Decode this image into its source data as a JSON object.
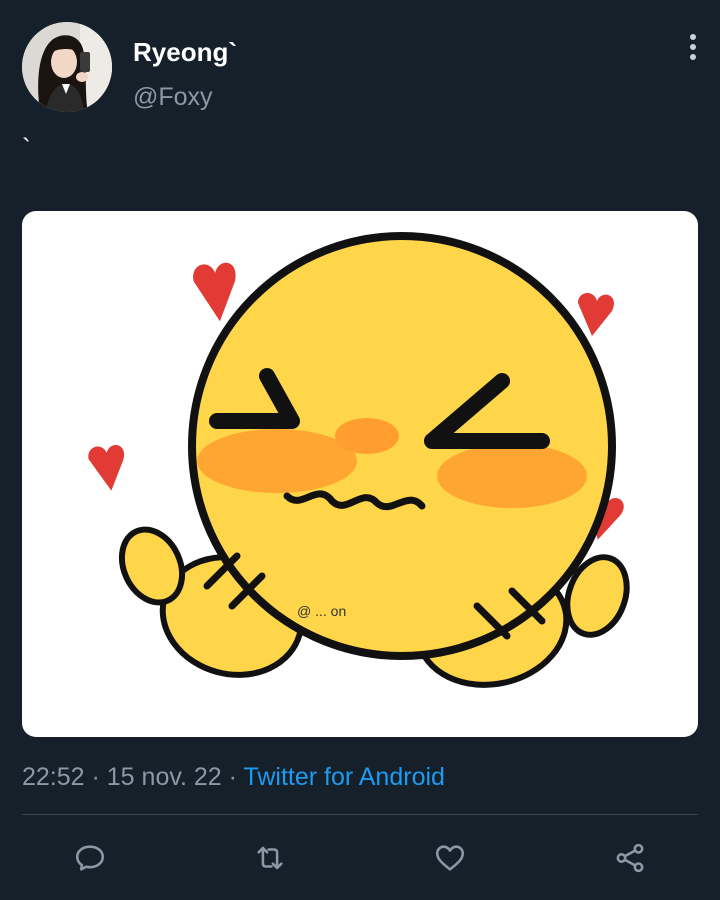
{
  "author": {
    "display_name": "Ryeong`",
    "handle": "@Foxy",
    "avatar_icon": "profile-photo"
  },
  "tweet": {
    "text": "`",
    "media_icon": "blushing-smiley-with-hearts",
    "media_watermark": "@ ... on"
  },
  "meta": {
    "time": "22:52",
    "sep1": " · ",
    "date": "15 nov. 22",
    "sep2": " · ",
    "source": "Twitter for Android"
  },
  "actions": {
    "reply_icon": "reply-icon",
    "retweet_icon": "retweet-icon",
    "like_icon": "heart-icon",
    "share_icon": "share-icon"
  },
  "colors": {
    "background": "#15202b",
    "muted": "#8b98a5",
    "link": "#1d9bf0",
    "divider": "#38444d"
  }
}
